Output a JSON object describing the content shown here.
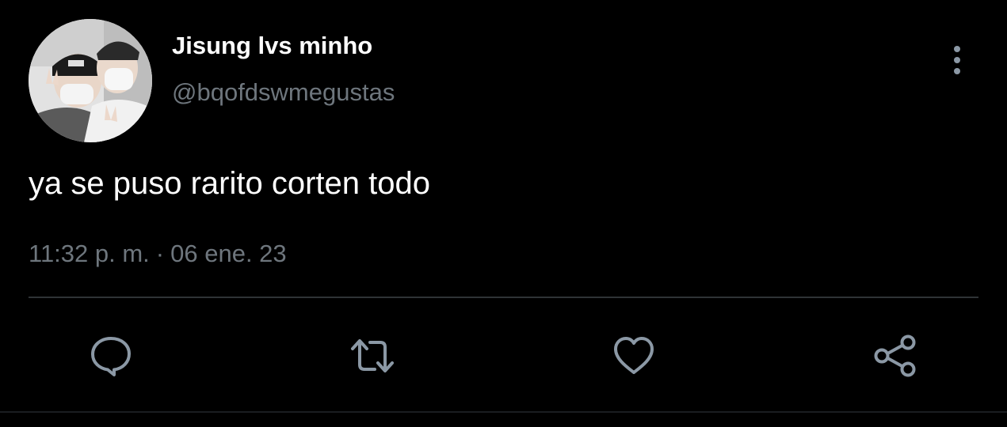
{
  "tweet": {
    "author": {
      "display_name": "Jisung lvs minho",
      "handle": "@bqofdswmegustas",
      "avatar": "profile-photo"
    },
    "text": "ya se puso rarito corten todo",
    "time": "11:32 p. m.",
    "separator": "·",
    "date": "06 ene. 23"
  },
  "actions": {
    "reply_icon": "speech-bubble-icon",
    "retweet_icon": "retweet-arrows-icon",
    "like_icon": "heart-icon",
    "share_icon": "share-nodes-icon",
    "more_icon": "vertical-ellipsis-icon"
  },
  "colors": {
    "background": "#000000",
    "primary_text": "#ffffff",
    "secondary_text": "#6e767d",
    "icon": "#8b98a5",
    "divider": "#2f3336"
  }
}
